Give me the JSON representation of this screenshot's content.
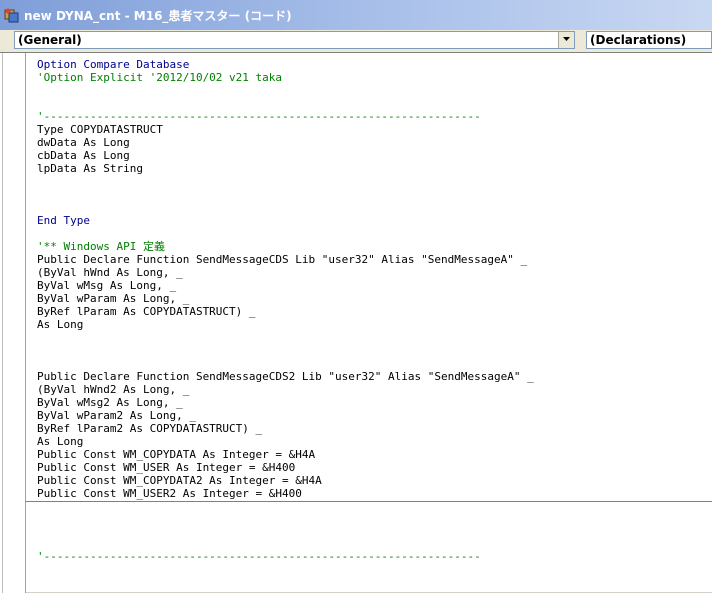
{
  "window": {
    "title": "new DYNA_cnt - M16_患者マスター (コード)",
    "icon": "vba-project-icon"
  },
  "object_combo": {
    "value": "(General)"
  },
  "procedure_combo": {
    "value": "(Declarations)"
  },
  "code_lines": [
    {
      "text": "Option Compare Database",
      "style": "kw"
    },
    {
      "text": "'Option Explicit '2012/10/02 v21 taka",
      "style": "cm"
    },
    {
      "text": "",
      "style": ""
    },
    {
      "text": "",
      "style": ""
    },
    {
      "text": "'------------------------------------------------------------------",
      "style": "cm"
    },
    {
      "text": "Type COPYDATASTRUCT",
      "style": ""
    },
    {
      "text": "dwData As Long",
      "style": ""
    },
    {
      "text": "cbData As Long",
      "style": ""
    },
    {
      "text": "lpData As String",
      "style": ""
    },
    {
      "text": "",
      "style": ""
    },
    {
      "text": "",
      "style": ""
    },
    {
      "text": "",
      "style": ""
    },
    {
      "text": "End Type",
      "style": "kw"
    },
    {
      "text": "",
      "style": ""
    },
    {
      "text": "'** Windows API 定義",
      "style": "cm"
    },
    {
      "text": "Public Declare Function SendMessageCDS Lib \"user32\" Alias \"SendMessageA\" _",
      "style": ""
    },
    {
      "text": "(ByVal hWnd As Long, _",
      "style": ""
    },
    {
      "text": "ByVal wMsg As Long, _",
      "style": ""
    },
    {
      "text": "ByVal wParam As Long, _",
      "style": ""
    },
    {
      "text": "ByRef lParam As COPYDATASTRUCT) _",
      "style": ""
    },
    {
      "text": "As Long",
      "style": ""
    },
    {
      "text": "",
      "style": ""
    },
    {
      "text": "",
      "style": ""
    },
    {
      "text": "",
      "style": ""
    },
    {
      "text": "Public Declare Function SendMessageCDS2 Lib \"user32\" Alias \"SendMessageA\" _",
      "style": ""
    },
    {
      "text": "(ByVal hWnd2 As Long, _",
      "style": ""
    },
    {
      "text": "ByVal wMsg2 As Long, _",
      "style": ""
    },
    {
      "text": "ByVal wParam2 As Long, _",
      "style": ""
    },
    {
      "text": "ByRef lParam2 As COPYDATASTRUCT) _",
      "style": ""
    },
    {
      "text": "As Long",
      "style": ""
    },
    {
      "text": "Public Const WM_COPYDATA As Integer = &H4A",
      "style": ""
    },
    {
      "text": "Public Const WM_USER As Integer = &H400",
      "style": ""
    },
    {
      "text": "Public Const WM_COPYDATA2 As Integer = &H4A",
      "style": ""
    },
    {
      "text": "Public Const WM_USER2 As Integer = &H400",
      "style": ""
    }
  ],
  "code_lines_2": [
    {
      "text": "'------------------------------------------------------------------",
      "style": "cm"
    }
  ]
}
